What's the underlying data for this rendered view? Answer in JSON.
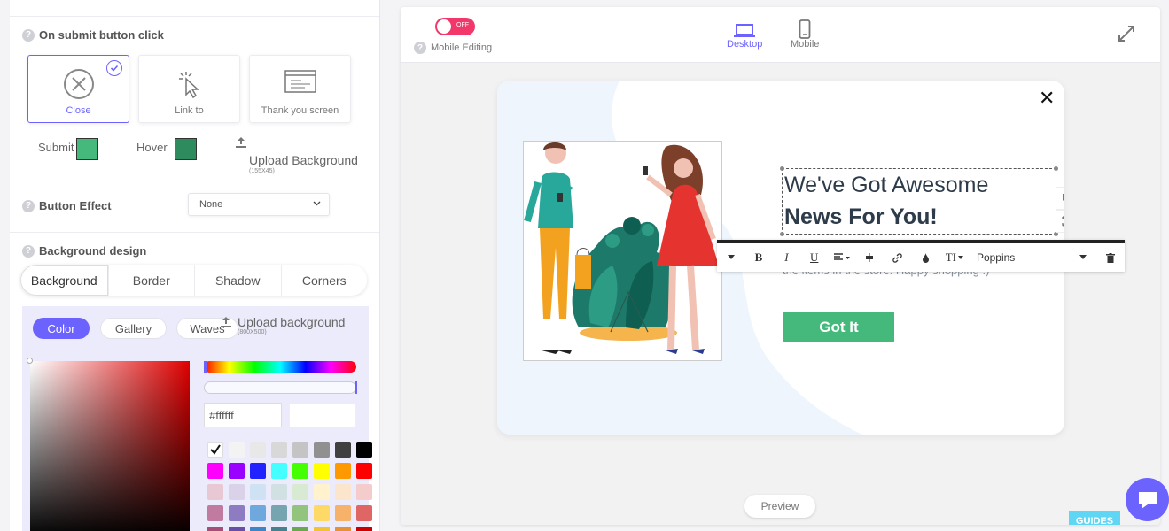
{
  "left": {
    "on_submit": {
      "title": "On submit button click",
      "options": [
        {
          "label": "Close",
          "icon": "close-circle-icon",
          "selected": true
        },
        {
          "label": "Link to",
          "icon": "cursor-click-icon",
          "selected": false
        },
        {
          "label": "Thank you screen",
          "icon": "screen-icon",
          "selected": false
        }
      ]
    },
    "submit_label": "Submit",
    "submit_color": "#45b97c",
    "hover_label": "Hover",
    "hover_color": "#2e8b5e",
    "upload_bg_label": "Upload Background",
    "upload_bg_size": "(155X45)",
    "button_effect": {
      "title": "Button Effect",
      "value": "None"
    },
    "background_design": {
      "title": "Background design",
      "tabs": [
        "Background",
        "Border",
        "Shadow",
        "Corners"
      ],
      "pills": [
        "Color",
        "Gallery",
        "Waves"
      ],
      "upload_label": "Upload background",
      "upload_size": "(800X500)",
      "hex_value": "#ffffff"
    },
    "palette": [
      "#ffffff",
      "#f3f3f3",
      "#e8e8e8",
      "#d8d8d8",
      "#c4c4c4",
      "#909090",
      "#404040",
      "#000000",
      "#ff00ff",
      "#9900ff",
      "#2222ff",
      "#44ffff",
      "#44ff00",
      "#ffff00",
      "#ff9900",
      "#ff0000",
      "#e8c9d3",
      "#d9d2e9",
      "#cfe2f3",
      "#d0e0e3",
      "#d9ead3",
      "#fff2cc",
      "#fce5cd",
      "#f4cccc",
      "#c27ba0",
      "#8e7cc3",
      "#6fa8dc",
      "#76a5af",
      "#93c47d",
      "#ffd966",
      "#f6b26b",
      "#e06666",
      "#a64d79",
      "#674ea7",
      "#3d85c6",
      "#45818e",
      "#6aa84f",
      "#f1c232",
      "#e69138",
      "#cc0000"
    ]
  },
  "editor": {
    "toggle_text": "OFF",
    "mobile_editing": "Mobile Editing",
    "devices": [
      {
        "label": "Desktop",
        "icon": "laptop-icon",
        "active": true
      },
      {
        "label": "Mobile",
        "icon": "phone-icon",
        "active": false
      }
    ],
    "popup": {
      "headline_light": "We've Got Awesome",
      "headline_bold": "News For You!",
      "subtext": "the items in the store. Happy shopping :)",
      "cta": "Got It",
      "close": "✕"
    },
    "format_bar": {
      "bold": "B",
      "italic": "I",
      "underline": "U",
      "font_size_glyph": "TI",
      "font": "Poppins"
    },
    "preview": "Preview",
    "guides": "GUIDES"
  },
  "colors": {
    "accent": "#6c63ff",
    "cta_green": "#45b97c",
    "toggle_red": "#f2386a"
  }
}
